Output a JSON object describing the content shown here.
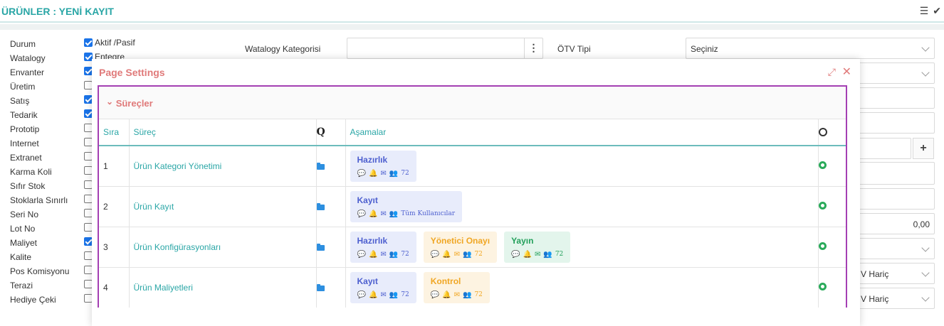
{
  "header": {
    "title": "ÜRÜNLER : YENİ KAYIT",
    "list_icon": "☰",
    "check_icon": "✔"
  },
  "fields": [
    {
      "label": "Durum",
      "checked": true,
      "text": "Aktif /Pasif"
    },
    {
      "label": "Watalogy",
      "checked": true,
      "text": "Entegre"
    },
    {
      "label": "Envanter",
      "checked": true,
      "text": ""
    },
    {
      "label": "Üretim",
      "checked": false,
      "text": ""
    },
    {
      "label": "Satış",
      "checked": true,
      "text": ""
    },
    {
      "label": "Tedarik",
      "checked": true,
      "text": ""
    },
    {
      "label": "Prototip",
      "checked": false,
      "text": ""
    },
    {
      "label": "Internet",
      "checked": false,
      "text": ""
    },
    {
      "label": "Extranet",
      "checked": false,
      "text": ""
    },
    {
      "label": "Karma Koli",
      "checked": false,
      "text": ""
    },
    {
      "label": "Sıfır Stok",
      "checked": false,
      "text": ""
    },
    {
      "label": "Stoklarla Sınırlı",
      "checked": false,
      "text": ""
    },
    {
      "label": "Seri No",
      "checked": false,
      "text": ""
    },
    {
      "label": "Lot No",
      "checked": false,
      "text": ""
    },
    {
      "label": "Maliyet",
      "checked": true,
      "text": ""
    },
    {
      "label": "Kalite",
      "checked": false,
      "text": ""
    },
    {
      "label": "Pos Komisyonu",
      "checked": false,
      "text": ""
    },
    {
      "label": "Terazi",
      "checked": false,
      "text": ""
    },
    {
      "label": "Hediye Çeki",
      "checked": false,
      "text": ""
    }
  ],
  "form": {
    "watalogy_category_label": "Watalogy Kategorisi",
    "kebab": "⋮",
    "otv_label": "ÖTV Tipi",
    "otv_value": "Seçiniz",
    "amount_value": "0,00",
    "vat_text_1": "V Hariç",
    "vat_text_2": "V Hariç",
    "plus": "+"
  },
  "modal": {
    "title": "Page Settings",
    "expand_icon": "⤢",
    "close_icon": "✕",
    "section_chevron": "⌄",
    "section_title": "Süreçler",
    "columns": {
      "sira": "Sıra",
      "surec": "Süreç",
      "q": "Q",
      "asamalar": "Aşamalar"
    },
    "rows": [
      {
        "no": "1",
        "name": "Ürün Kategori Yönetimi",
        "stages": [
          {
            "name": "Hazırlık",
            "color": "blue",
            "users": "72"
          }
        ]
      },
      {
        "no": "2",
        "name": "Ürün Kayıt",
        "stages": [
          {
            "name": "Kayıt",
            "color": "blue",
            "users": "Tüm Kullanıcılar"
          }
        ]
      },
      {
        "no": "3",
        "name": "Ürün Konfigürasyonları",
        "stages": [
          {
            "name": "Hazırlık",
            "color": "blue",
            "users": "72"
          },
          {
            "name": "Yönetici Onayı",
            "color": "orange",
            "users": "72"
          },
          {
            "name": "Yayın",
            "color": "green",
            "users": "72"
          }
        ]
      },
      {
        "no": "4",
        "name": "Ürün Maliyetleri",
        "stages": [
          {
            "name": "Kayıt",
            "color": "blue",
            "users": "72"
          },
          {
            "name": "Kontrol",
            "color": "orange",
            "users": "72"
          }
        ]
      }
    ]
  },
  "icons": {
    "comment": "💬",
    "bell": "🔔",
    "mail": "✉",
    "user": "👥"
  }
}
